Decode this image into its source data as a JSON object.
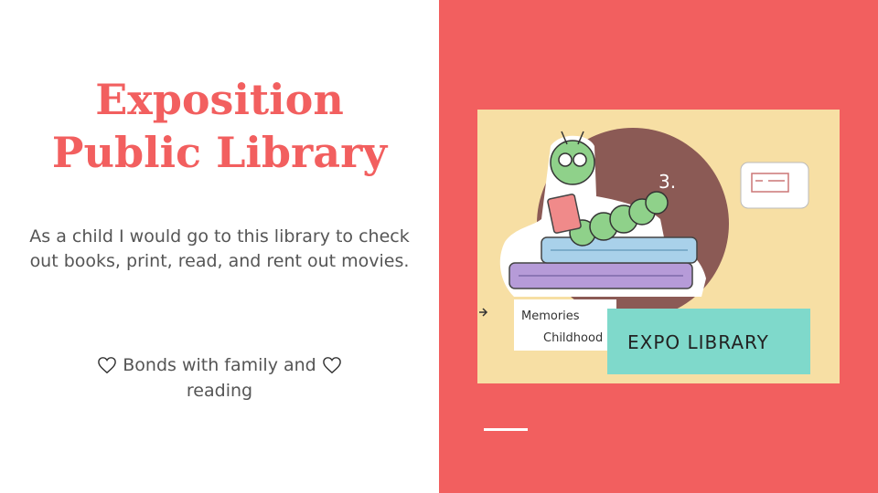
{
  "slide": {
    "title_line1": "Exposition",
    "title_line2": "Public Library",
    "description": "As a child I would go to this library to check out books, print, read, and rent out movies.",
    "bonds_text": "Bonds with family and",
    "bonds_text2": "reading",
    "heart_icon": "heart-outline-icon"
  },
  "photo": {
    "number_label": "3.",
    "memories_label_line1": "Memories",
    "memories_label_line2": "Childhood",
    "sign_label": "EXPO LIBRARY"
  },
  "colors": {
    "accent": "#f25f5f",
    "text": "#555555",
    "photo_bg": "#f7dfa4",
    "teal": "#7fd9cb",
    "brown_circle": "#8b5a55"
  }
}
